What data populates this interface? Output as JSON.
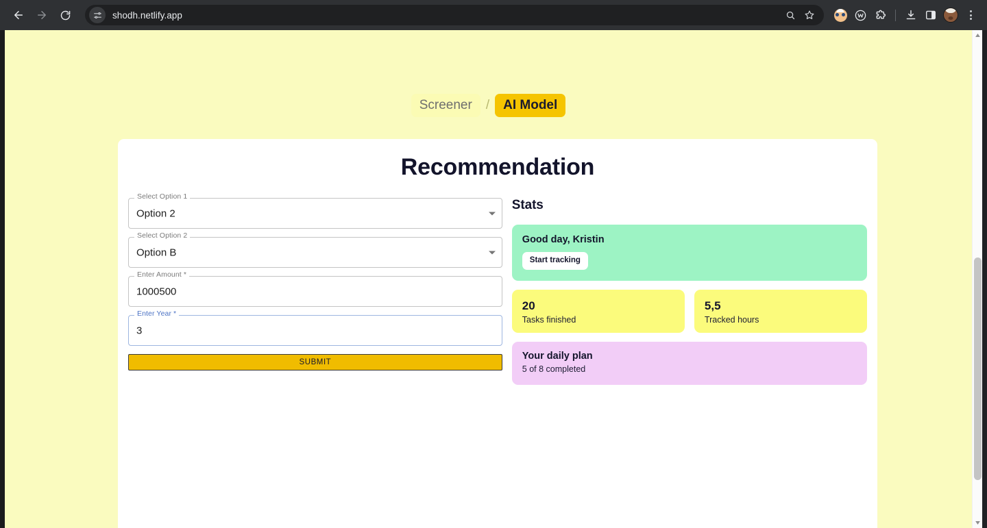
{
  "browser": {
    "back_icon": "back-arrow-icon",
    "forward_icon": "forward-arrow-icon",
    "reload_icon": "reload-icon",
    "site_info_icon": "site-settings-icon",
    "url": "shodh.netlify.app",
    "omnibox_search_icon": "search-icon",
    "omnibox_bookmark_icon": "bookmark-star-icon",
    "extension_face_icon": "extension-face-icon",
    "extension_w_icon": "extension-w-icon",
    "extensions_icon": "extensions-puzzle-icon",
    "download_icon": "download-icon",
    "side_panel_icon": "side-panel-icon",
    "avatar_icon": "profile-avatar-icon",
    "menu_icon": "chrome-menu-icon"
  },
  "breadcrumb": {
    "parent": "Screener",
    "separator": "/",
    "current": "AI Model"
  },
  "page": {
    "title": "Recommendation"
  },
  "form": {
    "fields": [
      {
        "label": "Select Option 1",
        "value": "Option 2",
        "type": "select",
        "required": false,
        "focused": false
      },
      {
        "label": "Select Option 2",
        "value": "Option B",
        "type": "select",
        "required": false,
        "focused": false
      },
      {
        "label": "Enter Amount *",
        "value": "1000500",
        "type": "text",
        "required": true,
        "focused": false
      },
      {
        "label": "Enter Year *",
        "value": "3",
        "type": "text",
        "required": true,
        "focused": true
      }
    ],
    "submit_label": "SUBMIT"
  },
  "stats": {
    "title": "Stats",
    "greeting": {
      "text": "Good day, Kristin",
      "button_label": "Start tracking"
    },
    "tiles": [
      {
        "value": "20",
        "label": "Tasks finished"
      },
      {
        "value": "5,5",
        "label": "Tracked hours"
      }
    ],
    "plan": {
      "title": "Your daily plan",
      "subtitle": "5 of 8 completed"
    }
  },
  "colors": {
    "page_background": "#fafbbf",
    "accent_gold": "#f5c400",
    "crumb_inactive": "#fbfbb4",
    "card_white": "#ffffff",
    "mint": "#9df3c4",
    "yellow_tile": "#fbfb7c",
    "lavender": "#f2cdf7",
    "text_dark": "#13142b",
    "submit_gold": "#f0bc00",
    "focus_blue": "#4b72c4"
  }
}
